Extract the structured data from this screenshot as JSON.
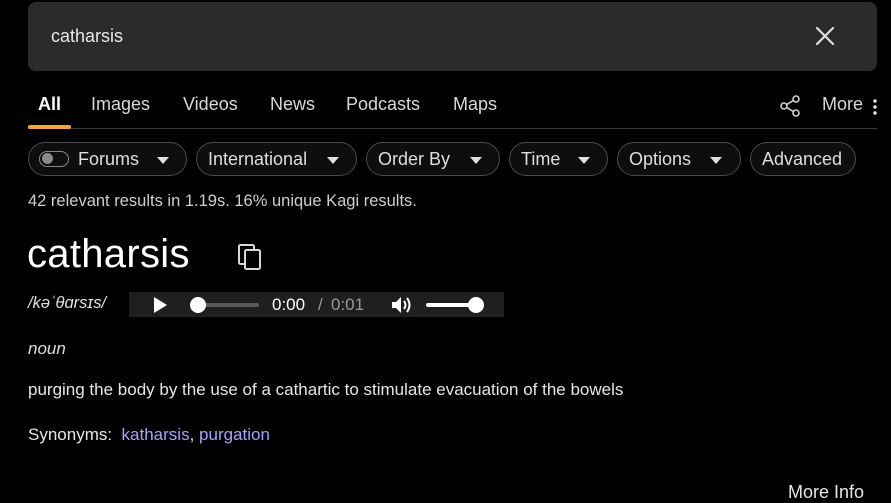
{
  "search": {
    "query": "catharsis",
    "clear_icon": "close-icon"
  },
  "tabs": [
    {
      "label": "All",
      "active": true
    },
    {
      "label": "Images"
    },
    {
      "label": "Videos"
    },
    {
      "label": "News"
    },
    {
      "label": "Podcasts"
    },
    {
      "label": "Maps"
    }
  ],
  "toolbar": {
    "share_icon": "share-icon",
    "more_label": "More",
    "more_icon": "kebab-icon"
  },
  "filters": [
    {
      "label": "Forums",
      "has_toggle": true,
      "toggle_on": false
    },
    {
      "label": "International"
    },
    {
      "label": "Order By"
    },
    {
      "label": "Time"
    },
    {
      "label": "Options"
    },
    {
      "label": "Advanced"
    }
  ],
  "stats": "42 relevant results in 1.19s. 16% unique Kagi results.",
  "dictionary": {
    "word": "catharsis",
    "phonetic": "/kəˈθɑrsɪs/",
    "audio": {
      "current": "0:00",
      "separator": "/",
      "duration": "0:01",
      "progress": 0,
      "volume": 1
    },
    "part_of_speech": "noun",
    "definition": "purging the body by the use of a cathartic to stimulate evacuation of the bowels",
    "synonyms_label": "Synonyms:",
    "synonyms": [
      "katharsis",
      "purgation"
    ],
    "synonym_separator": ", "
  },
  "more_info_label": "More Info",
  "colors": {
    "accent": "#f5a623",
    "link": "#a9a0ff",
    "background": "#000000",
    "search_bg": "#2b2b2d"
  }
}
